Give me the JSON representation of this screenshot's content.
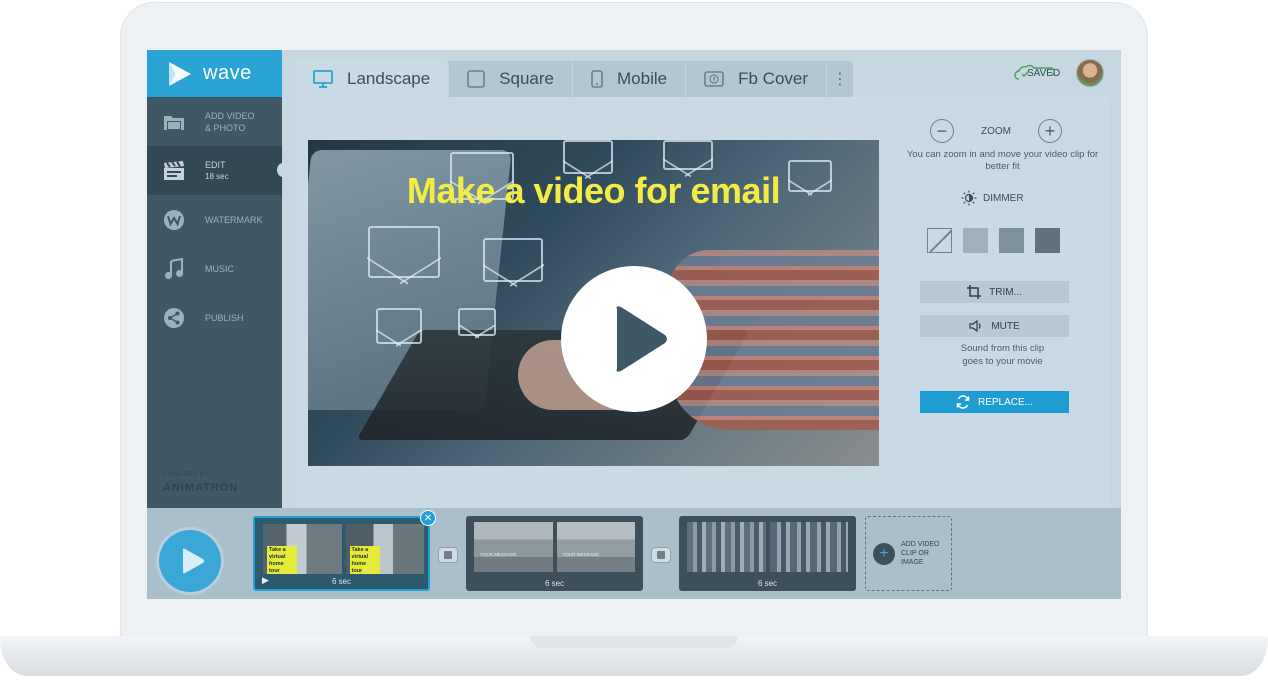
{
  "brand": {
    "name": "wave",
    "color": "#2aa4d5"
  },
  "sidebar": {
    "items": [
      {
        "label": "ADD VIDEO\n& PHOTO",
        "sub": "",
        "icon": "folder-icon"
      },
      {
        "label": "EDIT",
        "sub": "18 sec",
        "icon": "clapperboard-icon",
        "active": true
      },
      {
        "label": "WATERMARK",
        "sub": "",
        "icon": "watermark-icon"
      },
      {
        "label": "MUSIC",
        "sub": "",
        "icon": "music-note-icon"
      },
      {
        "label": "PUBLISH",
        "sub": "",
        "icon": "share-icon"
      }
    ],
    "powered_small": "POWERED BY",
    "powered_brand": "ANIMATRON"
  },
  "tabs": [
    {
      "label": "Landscape",
      "icon": "monitor-icon",
      "active": true
    },
    {
      "label": "Square",
      "icon": "square-icon"
    },
    {
      "label": "Mobile",
      "icon": "phone-icon"
    },
    {
      "label": "Fb Cover",
      "icon": "facebook-icon"
    }
  ],
  "header": {
    "saved_label": "SAVED"
  },
  "video": {
    "headline": "Make a video for email",
    "headline_color": "#f3ec44"
  },
  "panel": {
    "zoom_label": "ZOOM",
    "zoom_hint": "You can zoom in and move your video clip for better fit",
    "dimmer_label": "DIMMER",
    "dimmer_swatches": [
      "none",
      "#9eb0bb",
      "#7d919c",
      "#5e717c"
    ],
    "trim_label": "TRIM...",
    "mute_label": "MUTE",
    "mute_hint_1": "Sound from this clip",
    "mute_hint_2": "goes to your movie",
    "replace_label": "REPLACE...",
    "accent": "#1e9dd2"
  },
  "timeline": {
    "clips": [
      {
        "duration": "6 sec",
        "tag_text": "Take a virtual home tour",
        "selected": true
      },
      {
        "duration": "6 sec",
        "tag_text": "YOUR MESSAGE",
        "selected": false
      },
      {
        "duration": "6 sec",
        "tag_text": "",
        "selected": false
      }
    ],
    "add_label": "ADD VIDEO CLIP OR IMAGE"
  }
}
